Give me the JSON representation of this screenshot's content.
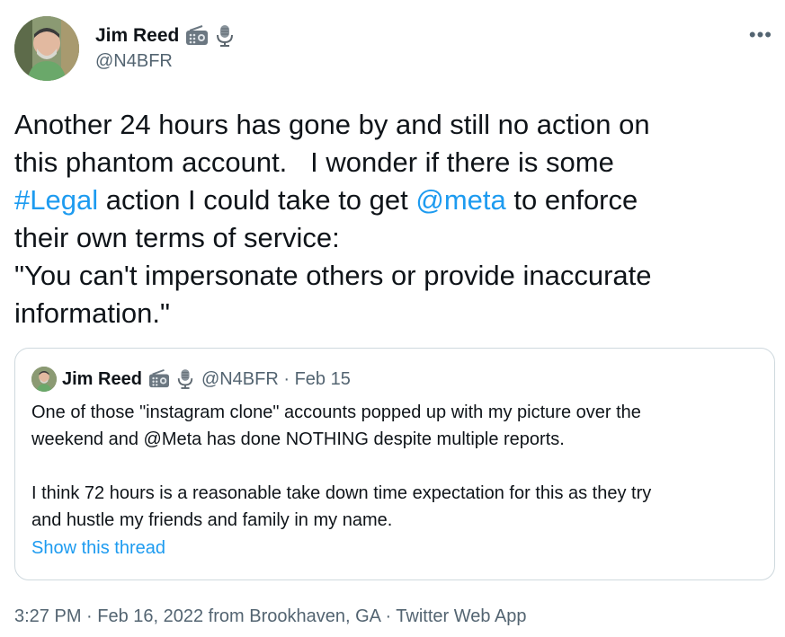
{
  "author": {
    "name": "Jim Reed",
    "handle": "@N4BFR",
    "badges": [
      "radio-icon",
      "microphone-icon"
    ]
  },
  "tweet": {
    "line1": "Another 24 hours has gone by and still no action on",
    "line2": "this phantom account.   I wonder if there is some",
    "hashtag": "#Legal",
    "line3_mid": " action I could take to get ",
    "mention": "@meta",
    "line3_end": " to enforce",
    "line4": "their own terms of service:",
    "line5": "\"You can't impersonate others or provide inaccurate",
    "line6": "information.\""
  },
  "more_label": "•••",
  "quote": {
    "name": "Jim Reed",
    "meta": "@N4BFR · Feb 15",
    "body": "One of those \"instagram clone\" accounts popped up with my picture over the\nweekend and @Meta has done NOTHING despite multiple reports.\n\nI think 72 hours is a reasonable take down time expectation for this as they try\nand hustle my friends and family in my name.",
    "show_thread": "Show this thread"
  },
  "footer": "3:27 PM · Feb 16, 2022 from Brookhaven, GA · Twitter Web App",
  "colors": {
    "link": "#1d9bf0",
    "secondary": "#536471",
    "border": "#cfd9de"
  }
}
